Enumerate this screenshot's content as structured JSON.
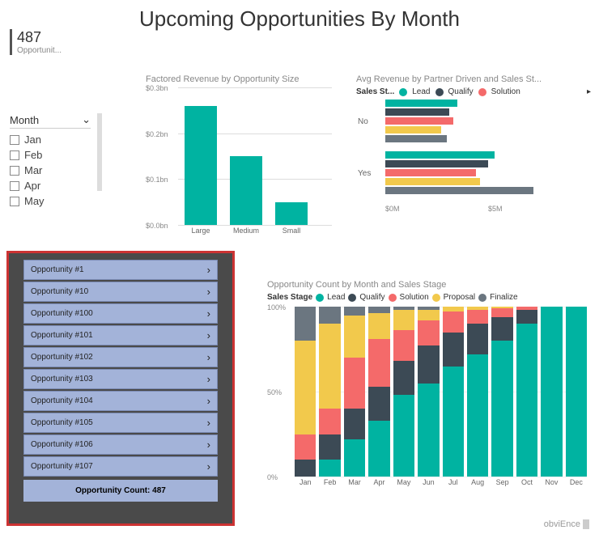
{
  "title": "Upcoming Opportunities By Month",
  "kpi": {
    "value": "487",
    "label": "Opportunit..."
  },
  "slicer": {
    "label": "Month",
    "items": [
      "Jan",
      "Feb",
      "Mar",
      "Apr",
      "May"
    ]
  },
  "factored": {
    "title": "Factored Revenue by Opportunity Size"
  },
  "avg": {
    "title": "Avg Revenue by Partner Driven and Sales St...",
    "legend_label": "Sales St...",
    "legend": [
      "Lead",
      "Qualify",
      "Solution"
    ]
  },
  "mobile": {
    "items": [
      "Opportunity #1",
      "Opportunity #10",
      "Opportunity #100",
      "Opportunity #101",
      "Opportunity #102",
      "Opportunity #103",
      "Opportunity #104",
      "Opportunity #105",
      "Opportunity #106",
      "Opportunity #107"
    ],
    "footer": "Opportunity Count: 487"
  },
  "stacked": {
    "title": "Opportunity Count by Month and Sales Stage",
    "legend_label": "Sales Stage",
    "legend": [
      "Lead",
      "Qualify",
      "Solution",
      "Proposal",
      "Finalize"
    ]
  },
  "brand": "obviEnce",
  "chart_data": [
    {
      "type": "bar",
      "title": "Factored Revenue by Opportunity Size",
      "categories": [
        "Large",
        "Medium",
        "Small"
      ],
      "values": [
        0.26,
        0.15,
        0.05
      ],
      "ylabel": "$bn",
      "ylim": [
        0,
        0.3
      ],
      "yticks": [
        "$0.0bn",
        "$0.1bn",
        "$0.2bn",
        "$0.3bn"
      ]
    },
    {
      "type": "bar",
      "orientation": "horizontal",
      "title": "Avg Revenue by Partner Driven and Sales Stage",
      "categories": [
        "No",
        "Yes"
      ],
      "xlim": [
        0,
        10
      ],
      "xticks": [
        "$0M",
        "$5M"
      ],
      "series": [
        {
          "name": "Lead",
          "values": [
            3.5,
            5.3
          ]
        },
        {
          "name": "Qualify",
          "values": [
            3.1,
            5.0
          ]
        },
        {
          "name": "Solution",
          "values": [
            3.3,
            4.4
          ]
        },
        {
          "name": "Proposal",
          "values": [
            2.7,
            4.6
          ]
        },
        {
          "name": "Finalize",
          "values": [
            3.0,
            7.2
          ]
        }
      ]
    },
    {
      "type": "bar",
      "stacked": true,
      "percent": true,
      "title": "Opportunity Count by Month and Sales Stage",
      "categories": [
        "Jan",
        "Feb",
        "Mar",
        "Apr",
        "May",
        "Jun",
        "Jul",
        "Aug",
        "Sep",
        "Oct",
        "Nov",
        "Dec"
      ],
      "ylim": [
        0,
        100
      ],
      "yticks": [
        "0%",
        "50%",
        "100%"
      ],
      "series": [
        {
          "name": "Lead",
          "values": [
            0,
            10,
            22,
            33,
            48,
            55,
            65,
            72,
            80,
            90,
            100,
            100
          ]
        },
        {
          "name": "Qualify",
          "values": [
            10,
            15,
            18,
            20,
            20,
            22,
            20,
            18,
            14,
            8,
            0,
            0
          ]
        },
        {
          "name": "Solution",
          "values": [
            15,
            15,
            30,
            28,
            18,
            15,
            12,
            8,
            5,
            2,
            0,
            0
          ]
        },
        {
          "name": "Proposal",
          "values": [
            55,
            50,
            25,
            15,
            12,
            6,
            3,
            2,
            1,
            0,
            0,
            0
          ]
        },
        {
          "name": "Finalize",
          "values": [
            20,
            10,
            5,
            4,
            2,
            2,
            0,
            0,
            0,
            0,
            0,
            0
          ]
        }
      ]
    }
  ]
}
